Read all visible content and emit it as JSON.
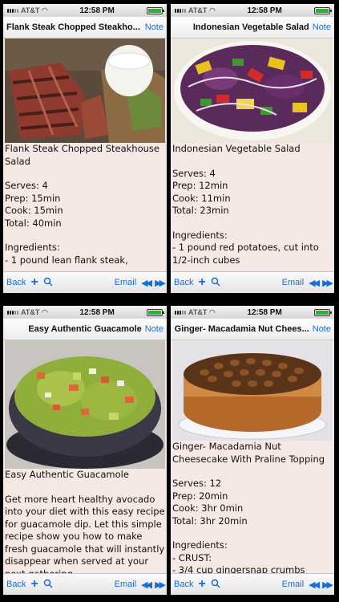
{
  "status": {
    "carrier": "AT&T",
    "time": "12:58 PM"
  },
  "toolbar": {
    "back": "Back",
    "email": "Email"
  },
  "nav_note": "Note",
  "screens": [
    {
      "nav_title": "Flank Steak Chopped Steakho...",
      "title": "Flank Steak Chopped Steakhouse Salad",
      "body": "Serves: 4\nPrep: 15min\nCook: 15min\nTotal: 40min",
      "body2": "Ingredients:\n- 1 pound lean flank steak,"
    },
    {
      "nav_title": "Indonesian Vegetable Salad",
      "title": "Indonesian Vegetable Salad",
      "body": "Serves: 4\nPrep: 12min\nCook: 11min\nTotal: 23min",
      "body2": "Ingredients:\n- 1 pound red potatoes, cut into\n1/2-inch cubes"
    },
    {
      "nav_title": "Easy Authentic Guacamole",
      "title": "Easy Authentic Guacamole",
      "body": "Get more heart healthy avocado into your diet with this easy recipe for guacamole dip. Let this simple recipe show you how to make fresh guacamole that will instantly disappear when served at your next gathering."
    },
    {
      "nav_title": "Ginger- Macadamia Nut Chees...",
      "title": "Ginger- Macadamia Nut Cheesecake With Praline Topping",
      "body": "Serves: 12\nPrep: 20min\nCook: 3hr 0min\nTotal: 3hr 20min",
      "body2": "Ingredients:\n- CRUST:\n- 3/4 cup gingersnap crumbs"
    }
  ]
}
